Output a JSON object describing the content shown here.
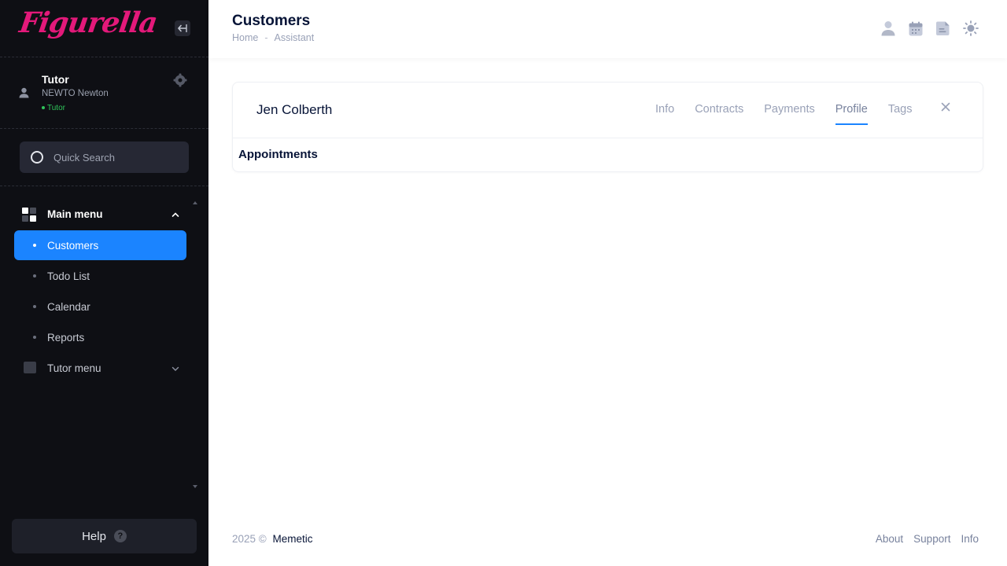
{
  "app": {
    "logo_text": "Figurella",
    "accent": "#1b84ff",
    "sidebar_bg": "#0e0f14",
    "logo_color": "#e3197a"
  },
  "user": {
    "name": "Tutor",
    "org": "NEWTO Newton",
    "role": "Tutor"
  },
  "search": {
    "placeholder": "Quick Search"
  },
  "sidebar": {
    "main_menu_label": "Main menu",
    "items": [
      {
        "label": "Customers",
        "active": true
      },
      {
        "label": "Todo List",
        "active": false
      },
      {
        "label": "Calendar",
        "active": false
      },
      {
        "label": "Reports",
        "active": false
      }
    ],
    "tutor_menu_label": "Tutor menu",
    "help_label": "Help"
  },
  "header": {
    "title": "Customers",
    "breadcrumb": [
      "Home",
      "Assistant"
    ],
    "breadcrumb_separator": "-",
    "icons": [
      "user-icon",
      "calendar-icon",
      "document-icon",
      "sun-icon"
    ]
  },
  "card": {
    "customer_name": "Jen Colberth",
    "tabs": [
      {
        "label": "Info",
        "active": false
      },
      {
        "label": "Contracts",
        "active": false
      },
      {
        "label": "Payments",
        "active": false
      },
      {
        "label": "Profile",
        "active": true
      },
      {
        "label": "Tags",
        "active": false
      }
    ],
    "section_title": "Appointments"
  },
  "footer": {
    "year": "2025 ©",
    "brand": "Memetic",
    "links": [
      "About",
      "Support",
      "Info"
    ]
  }
}
